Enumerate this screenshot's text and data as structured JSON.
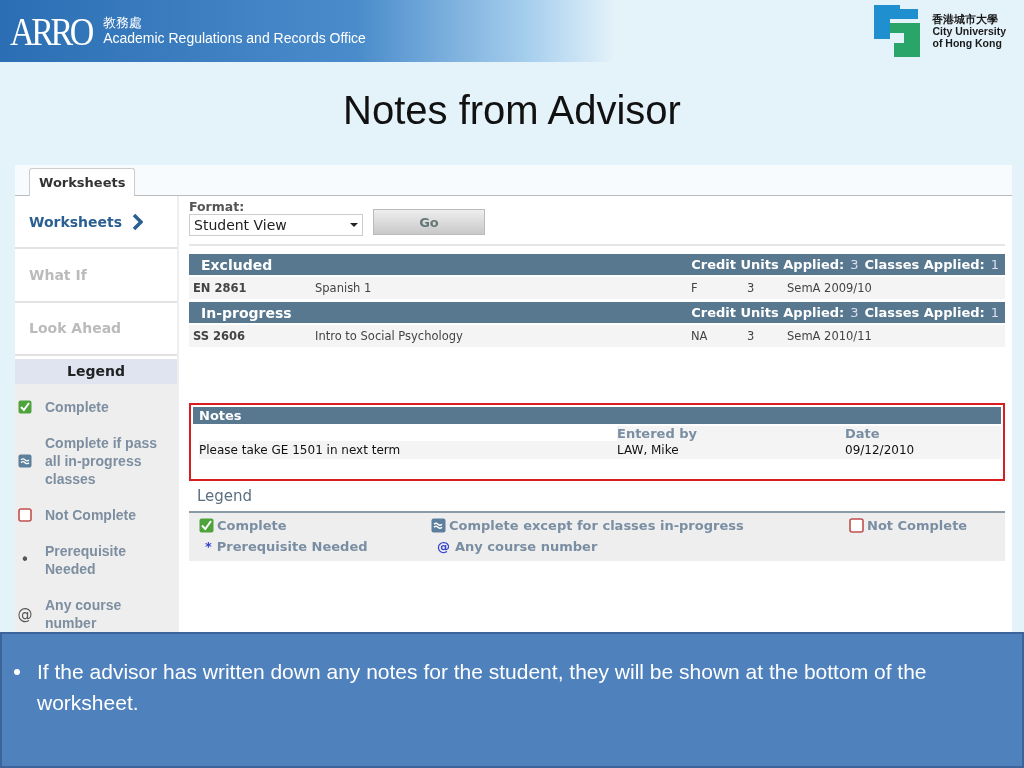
{
  "header": {
    "office_abbr": "ARRO",
    "office_chinese": "教務處",
    "office_name": "Academic Regulations and Records Office",
    "university_chinese": "香港城市大學",
    "university_name": [
      "City University",
      "of Hong Kong"
    ]
  },
  "slide_title": "Notes from Advisor",
  "worksheet": {
    "tabs": [
      {
        "label": "Worksheets",
        "selected": true
      }
    ],
    "sidebar": {
      "items": [
        {
          "label": "Worksheets",
          "selected": true
        },
        {
          "label": "What If",
          "selected": false
        },
        {
          "label": "Look Ahead",
          "selected": false
        }
      ],
      "legend_title": "Legend",
      "legend": [
        {
          "kind": "complete",
          "label": "Complete"
        },
        {
          "kind": "in-progress",
          "label": "Complete if pass all in-progress classes"
        },
        {
          "kind": "not-complete",
          "label": "Not Complete"
        },
        {
          "kind": "prerequisite",
          "symbol": "•",
          "label": "Prerequisite Needed"
        },
        {
          "kind": "any-course",
          "symbol": "@",
          "label": "Any course number"
        }
      ]
    },
    "format_label": "Format:",
    "format_value": "Student View",
    "go_button": "Go",
    "sections": [
      {
        "title": "Excluded",
        "credit_label": "Credit Units Applied:",
        "credit_value": "3",
        "classes_label": "Classes Applied:",
        "classes_value": "1",
        "rows": [
          {
            "course": "EN 2861",
            "title": "Spanish 1",
            "grade": "F",
            "units": "3",
            "term": "SemA 2009/10"
          }
        ]
      },
      {
        "title": "In-progress",
        "credit_label": "Credit Units Applied:",
        "credit_value": "3",
        "classes_label": "Classes Applied:",
        "classes_value": "1",
        "rows": [
          {
            "course": "SS 2606",
            "title": "Intro to Social Psychology",
            "grade": "NA",
            "units": "3",
            "term": "SemA 2010/11"
          }
        ]
      }
    ],
    "notes": {
      "title": "Notes",
      "highlighted": true,
      "columns": [
        "Entered by",
        "Date"
      ],
      "rows": [
        {
          "note": "Please take GE 1501 in next term",
          "entered_by": "LAW, Mike",
          "date": "09/12/2010"
        }
      ]
    },
    "legend": {
      "title": "Legend",
      "items": [
        {
          "kind": "complete",
          "label": "Complete"
        },
        {
          "kind": "in-progress",
          "label": "Complete except for classes in-progress"
        },
        {
          "kind": "not-complete",
          "label": "Not Complete"
        },
        {
          "kind": "prerequisite",
          "symbol": "*",
          "label": "Prerequisite Needed"
        },
        {
          "kind": "any-course",
          "symbol": "@",
          "label": "Any course number"
        }
      ]
    }
  },
  "bullets": [
    "If the advisor has written down any notes for the student, they will be shown at the bottom of the worksheet."
  ]
}
